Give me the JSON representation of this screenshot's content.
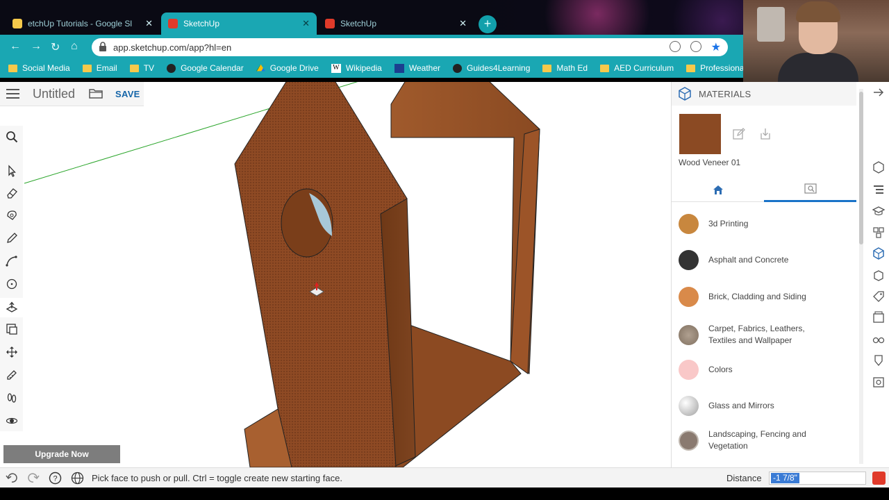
{
  "browser": {
    "tabs": [
      {
        "title": "etchUp Tutorials - Google Sl",
        "favicon_color": "#f6c94b",
        "active": false
      },
      {
        "title": "SketchUp",
        "favicon_color": "#e03a2a",
        "active": true
      },
      {
        "title": "SketchUp",
        "favicon_color": "#e03a2a",
        "active": false
      }
    ],
    "url": "app.sketchup.com/app?hl=en",
    "bookmarks": [
      {
        "label": "Social Media",
        "icon": "folder-icon"
      },
      {
        "label": "Email",
        "icon": "folder-icon"
      },
      {
        "label": "TV",
        "icon": "folder-icon"
      },
      {
        "label": "Google Calendar",
        "icon": "calendar-icon"
      },
      {
        "label": "Google Drive",
        "icon": "drive-icon"
      },
      {
        "label": "Wikipedia",
        "icon": "wikipedia-icon"
      },
      {
        "label": "Weather",
        "icon": "weather-icon"
      },
      {
        "label": "Guides4Learning",
        "icon": "globe-icon"
      },
      {
        "label": "Math Ed",
        "icon": "folder-icon"
      },
      {
        "label": "AED Curriculum",
        "icon": "folder-icon"
      },
      {
        "label": "Professional Develo...",
        "icon": "folder-icon"
      }
    ]
  },
  "app": {
    "document_title": "Untitled",
    "save_label": "SAVE",
    "upgrade_label": "Upgrade Now"
  },
  "materials": {
    "header": "MATERIALS",
    "selected_name": "Wood Veneer 01",
    "selected_color": "#8b4a23",
    "categories": [
      {
        "label": "3d Printing",
        "color": "#c8873e"
      },
      {
        "label": "Asphalt and Concrete",
        "color": "#333333"
      },
      {
        "label": "Brick, Cladding and Siding",
        "color": "#d98a4a"
      },
      {
        "label": "Carpet, Fabrics, Leathers, Textiles and Wallpaper",
        "color": "#9a8878"
      },
      {
        "label": "Colors",
        "color": "#f9c8c8"
      },
      {
        "label": "Glass and Mirrors",
        "color": "#c0c0c0"
      },
      {
        "label": "Landscaping, Fencing and Vegetation",
        "color": "#8a7a70"
      }
    ]
  },
  "status": {
    "message": "Pick face to push or pull. Ctrl = toggle create new starting face.",
    "distance_label": "Distance",
    "distance_value": "-1 7/8\""
  }
}
